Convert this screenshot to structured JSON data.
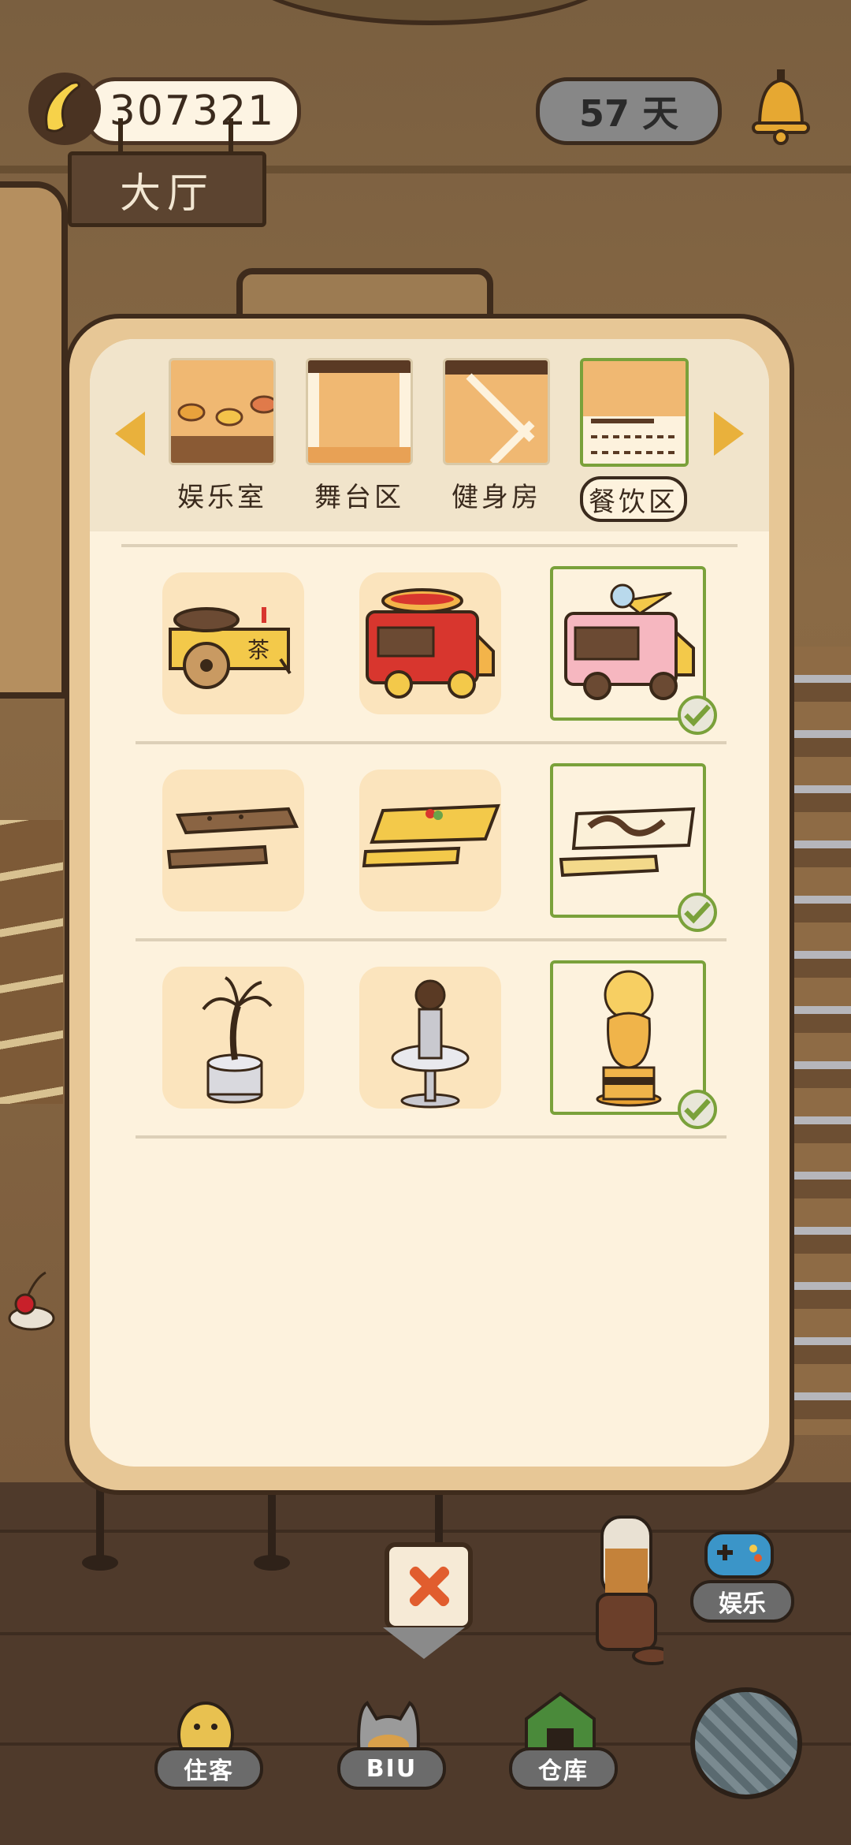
{
  "hud": {
    "coins": "307321",
    "room_name": "大厅",
    "days": "57 天",
    "icons": [
      "banana-icon",
      "bell-icon"
    ]
  },
  "tabs": [
    {
      "label": "娱乐室",
      "active": false
    },
    {
      "label": "舞台区",
      "active": false
    },
    {
      "label": "健身房",
      "active": false
    },
    {
      "label": "餐饮区",
      "active": true
    }
  ],
  "tea_cart_sign": "茶",
  "items": [
    {
      "name": "tea-cart",
      "owned": false
    },
    {
      "name": "hotdog-truck",
      "owned": false
    },
    {
      "name": "ice-cream-truck",
      "owned": true
    },
    {
      "name": "chocolate-bench",
      "owned": false
    },
    {
      "name": "cream-table",
      "owned": false
    },
    {
      "name": "chocolate-cream-bench",
      "owned": true
    },
    {
      "name": "palm-tree-statue",
      "owned": false
    },
    {
      "name": "chocolate-fountain",
      "owned": false
    },
    {
      "name": "golden-statue",
      "owned": true
    }
  ],
  "bottom_nav": [
    {
      "label": "住客"
    },
    {
      "label": "BIU"
    },
    {
      "label": "仓库"
    }
  ],
  "entertainment_label": "娱乐",
  "colors": {
    "accent_green": "#7aa13a",
    "arrow_yellow": "#e9b13c",
    "close_red": "#e15d2e",
    "panel_bg": "#fdf2dd"
  }
}
